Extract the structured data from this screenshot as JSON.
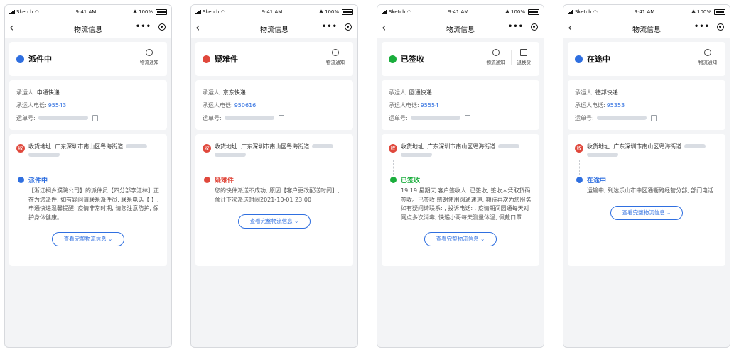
{
  "status_bar": {
    "carrier": "Sketch",
    "time": "9:41 AM",
    "battery": "100%"
  },
  "nav": {
    "title": "物流信息",
    "more": "•••"
  },
  "labels": {
    "carrier": "承运人:",
    "carrier_phone": "承运人电话:",
    "tracking_no": "运单号:",
    "address_badge": "收",
    "address": "收货地址: 广东深圳市南山区粤海街道",
    "notify": "物流通知",
    "return": "退换货",
    "more_btn": "查看完整物流信息 ⌄"
  },
  "colors": {
    "blue": "#2f6fe0",
    "red": "#e0483c",
    "green": "#1aad3c"
  },
  "screens": [
    {
      "status": "派件中",
      "status_icon": "clock-icon",
      "color": "blue",
      "carrier": "申通快递",
      "phone": "95543",
      "event_title": "派件中",
      "event_body": "【浙江桐乡濮院公司】的派件员【四分部李江林】正在为您派件, 如有疑问请联系派件员, 联系电话【 】, 申通快递温馨提醒: 疫情非常时期, 请您注意防护, 保护身体健康。"
    },
    {
      "status": "疑难件",
      "status_icon": "question-icon",
      "color": "red",
      "carrier": "京东快递",
      "phone": "950616",
      "event_title": "疑难件",
      "event_body": "您的快件派送不成功, 原因【客户更改配送时间】, 预计下次派送时间2021-10-01 23:00"
    },
    {
      "status": "已签收",
      "status_icon": "check-icon",
      "color": "green",
      "carrier": "圆通快递",
      "phone": "95554",
      "event_title": "已签收",
      "event_body": "19:19 星期天 客户签收人: 已签收, 签收人凭取货码签收。已签收 感谢使用圆通速递, 期待再次为您服务 如有疑问请联系: , 投诉电话: , 疫情期间圆通每天对网点多次消毒, 快递小哥每天测量体温, 佩戴口罩"
    },
    {
      "status": "在途中",
      "status_icon": "clock-icon",
      "color": "blue",
      "carrier": "德邦快递",
      "phone": "95353",
      "event_title": "在途中",
      "event_body": "运输中, 到达乐山市中区通衢路经营分部, 部门电话:"
    }
  ]
}
